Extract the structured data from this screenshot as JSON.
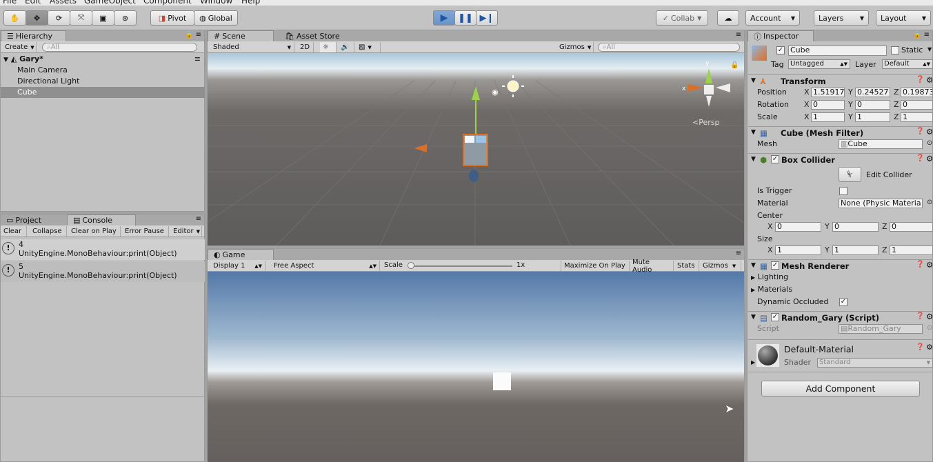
{
  "menu": [
    "File",
    "Edit",
    "Assets",
    "GameObject",
    "Component",
    "Window",
    "Help"
  ],
  "toolbar": {
    "pivot": "Pivot",
    "global": "Global",
    "collab": "Collab",
    "account": "Account",
    "layers": "Layers",
    "layout": "Layout"
  },
  "hierarchy": {
    "tab": "Hierarchy",
    "create": "Create",
    "search": "All",
    "scene": "Gary*",
    "items": [
      "Main Camera",
      "Directional Light",
      "Cube"
    ]
  },
  "console": {
    "tab_project": "Project",
    "tab_console": "Console",
    "buttons": [
      "Clear",
      "Collapse",
      "Clear on Play",
      "Error Pause",
      "Editor"
    ],
    "logs": [
      {
        "value": "4",
        "msg": "UnityEngine.MonoBehaviour:print(Object)"
      },
      {
        "value": "5",
        "msg": "UnityEngine.MonoBehaviour:print(Object)"
      }
    ]
  },
  "scene": {
    "tab": "Scene",
    "tab2": "Asset Store",
    "shaded": "Shaded",
    "mode2d": "2D",
    "gizmos": "Gizmos",
    "search": "All",
    "persp": "Persp",
    "axis_x": "x",
    "axis_y": "y"
  },
  "game": {
    "tab": "Game",
    "display": "Display 1",
    "aspect": "Free Aspect",
    "scale": "Scale",
    "scale_val": "1x",
    "maximize": "Maximize On Play",
    "mute": "Mute Audio",
    "stats": "Stats",
    "gizmos": "Gizmos"
  },
  "inspector": {
    "tab": "Inspector",
    "name": "Cube",
    "static": "Static",
    "tag_label": "Tag",
    "tag": "Untagged",
    "layer_label": "Layer",
    "layer": "Default",
    "transform": {
      "title": "Transform",
      "position": "Position",
      "rotation": "Rotation",
      "scale": "Scale",
      "pos": [
        "1.51917",
        "0.24527",
        "0.19873"
      ],
      "rot": [
        "0",
        "0",
        "0"
      ],
      "scl": [
        "1",
        "1",
        "1"
      ]
    },
    "mesh_filter": {
      "title": "Cube (Mesh Filter)",
      "mesh_label": "Mesh",
      "mesh": "Cube"
    },
    "box_collider": {
      "title": "Box Collider",
      "edit": "Edit Collider",
      "is_trigger": "Is Trigger",
      "material_label": "Material",
      "material": "None (Physic Materia",
      "center": "Center",
      "size": "Size",
      "c": [
        "0",
        "0",
        "0"
      ],
      "s": [
        "1",
        "1",
        "1"
      ]
    },
    "mesh_renderer": {
      "title": "Mesh Renderer",
      "lighting": "Lighting",
      "materials": "Materials",
      "dynamic": "Dynamic Occluded"
    },
    "script": {
      "title": "Random_Gary (Script)",
      "label": "Script",
      "value": "Random_Gary"
    },
    "material": {
      "name": "Default-Material",
      "shader_label": "Shader",
      "shader": "Standard"
    },
    "add": "Add Component"
  },
  "labels": {
    "x": "X",
    "y": "Y",
    "z": "Z"
  }
}
